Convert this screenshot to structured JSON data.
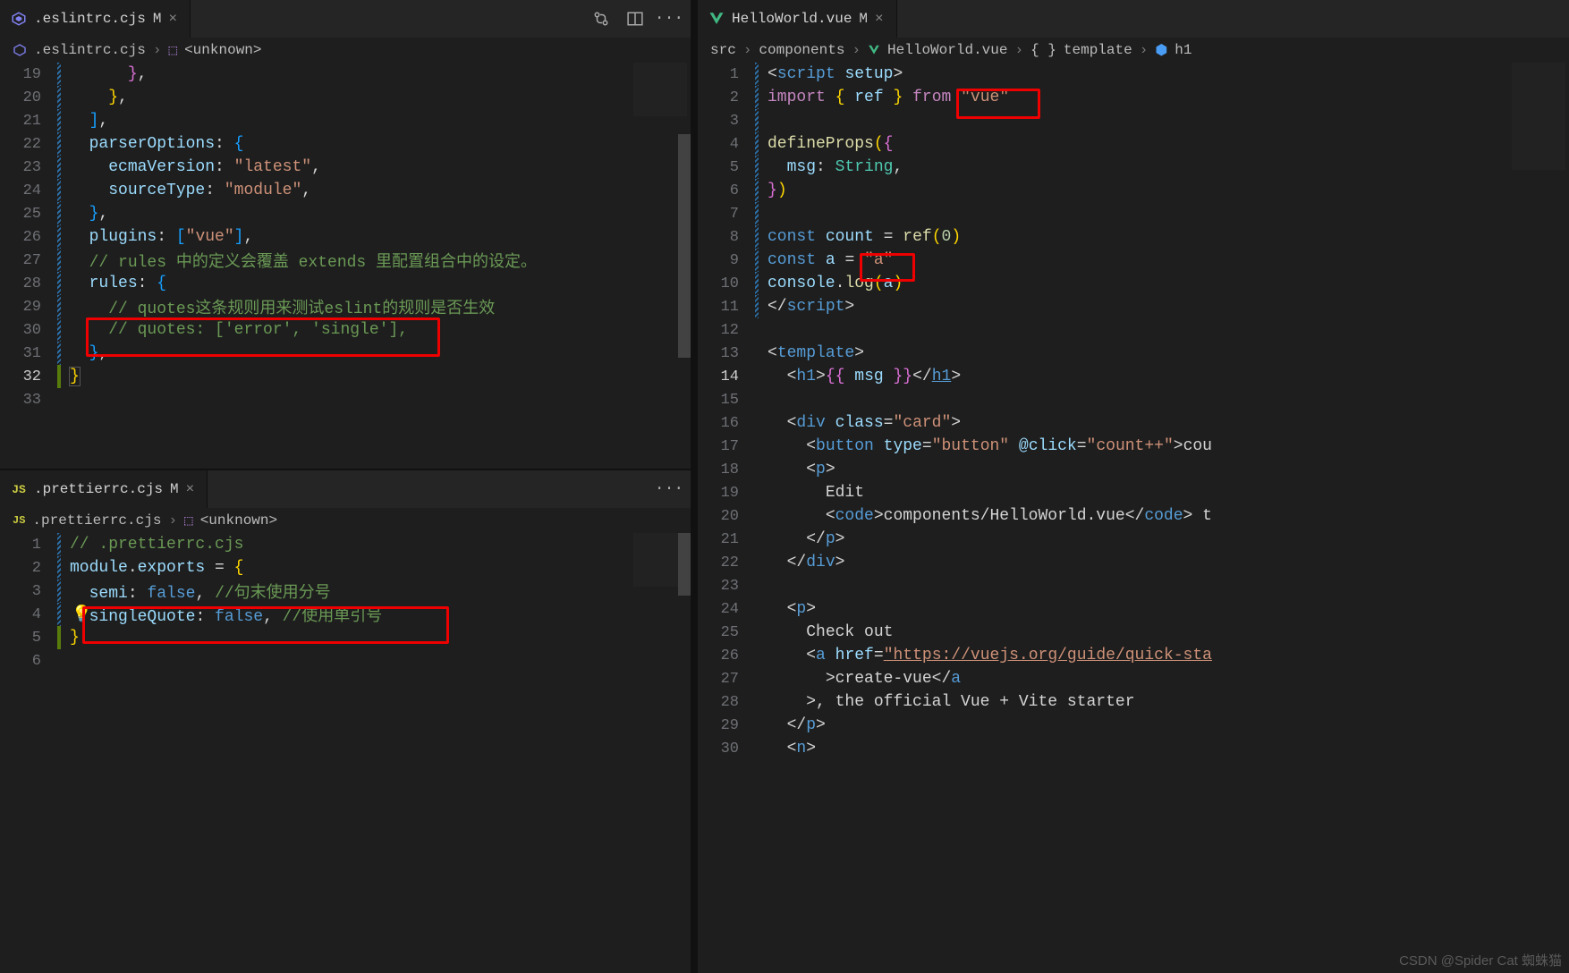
{
  "left_top": {
    "tab": {
      "name": ".eslintrc.cjs",
      "mod": "M"
    },
    "crumbs": [
      ".eslintrc.cjs",
      "<unknown>"
    ],
    "lines": [
      {
        "n": "19",
        "cls": "mod",
        "html": "      <span class='br2'>}</span><span class='pc'>,</span>"
      },
      {
        "n": "20",
        "cls": "mod",
        "html": "    <span class='br1'>}</span><span class='pc'>,</span>"
      },
      {
        "n": "21",
        "cls": "mod",
        "html": "  <span class='br3'>]</span><span class='pc'>,</span>"
      },
      {
        "n": "22",
        "cls": "mod",
        "html": "  <span class='ky'>parserOptions</span><span class='pc'>: </span><span class='br3'>{</span>"
      },
      {
        "n": "23",
        "cls": "mod",
        "html": "    <span class='ky'>ecmaVersion</span><span class='pc'>: </span><span class='st'>\"latest\"</span><span class='pc'>,</span>"
      },
      {
        "n": "24",
        "cls": "mod",
        "html": "    <span class='ky'>sourceType</span><span class='pc'>: </span><span class='st'>\"module\"</span><span class='pc'>,</span>"
      },
      {
        "n": "25",
        "cls": "mod",
        "html": "  <span class='br3'>}</span><span class='pc'>,</span>"
      },
      {
        "n": "26",
        "cls": "mod",
        "html": "  <span class='ky'>plugins</span><span class='pc'>: </span><span class='br3'>[</span><span class='st'>\"vue\"</span><span class='br3'>]</span><span class='pc'>,</span>"
      },
      {
        "n": "27",
        "cls": "mod",
        "html": "  <span class='ch'>// rules 中的定义会覆盖 extends 里配置组合中的设定。</span>"
      },
      {
        "n": "28",
        "cls": "mod",
        "html": "  <span class='ky'>rules</span><span class='pc'>: </span><span class='br3'>{</span>"
      },
      {
        "n": "29",
        "cls": "mod",
        "html": "    <span class='ch'>// quotes这条规则用来测试eslint的规则是否生效</span>"
      },
      {
        "n": "30",
        "cls": "mod",
        "html": "    <span class='ch'>// quotes: ['error', 'single'],</span>"
      },
      {
        "n": "31",
        "cls": "mod",
        "html": "  <span class='br3'>}</span><span class='pc'>,</span>"
      },
      {
        "n": "32",
        "cls": "add",
        "hl": true,
        "html": "<span class='br1' style='outline:1px solid #555'>}</span>"
      },
      {
        "n": "33",
        "cls": "",
        "html": ""
      }
    ]
  },
  "left_bottom": {
    "tab": {
      "name": ".prettierrc.cjs",
      "mod": "M"
    },
    "crumbs": [
      ".prettierrc.cjs",
      "<unknown>"
    ],
    "lines": [
      {
        "n": "1",
        "cls": "mod",
        "html": "<span class='ch'>// .prettierrc.cjs</span>"
      },
      {
        "n": "2",
        "cls": "mod",
        "html": "<span class='va'>module</span><span class='pc'>.</span><span class='va'>exports</span><span class='pc'> = </span><span class='br1'>{</span>"
      },
      {
        "n": "3",
        "cls": "mod",
        "html": "  <span class='ky'>semi</span><span class='pc'>: </span><span class='kw'>false</span><span class='pc'>, </span><span class='ch'>//句末使用分号</span>"
      },
      {
        "n": "4",
        "cls": "mod",
        "html": "  <span class='ky'>singleQuote</span><span class='pc'>: </span><span class='kw'>false</span><span class='pc'>, </span><span class='ch'>//使用单引号</span>"
      },
      {
        "n": "5",
        "cls": "add",
        "html": "<span class='br1'>}</span>"
      },
      {
        "n": "6",
        "cls": "",
        "html": ""
      }
    ]
  },
  "right": {
    "tab": {
      "name": "HelloWorld.vue",
      "mod": "M"
    },
    "crumbs": [
      "src",
      "components",
      "HelloWorld.vue",
      "template",
      "h1"
    ],
    "lines": [
      {
        "n": "1",
        "cls": "mod",
        "html": "<span class='pc'>&lt;</span><span class='tg'>script</span> <span class='at'>setup</span><span class='pc'>&gt;</span>"
      },
      {
        "n": "2",
        "cls": "mod",
        "html": "<span class='pc2'>import</span> <span class='br1'>{</span> <span class='va'>ref</span> <span class='br1'>}</span> <span class='pc2'>from</span> <span class='st'>\"vue\"</span>"
      },
      {
        "n": "3",
        "cls": "mod",
        "html": ""
      },
      {
        "n": "4",
        "cls": "mod",
        "html": "<span class='fn'>defineProps</span><span class='br1'>(</span><span class='br2'>{</span>"
      },
      {
        "n": "5",
        "cls": "mod",
        "html": "  <span class='ky'>msg</span><span class='pc'>: </span><span class='ty'>String</span><span class='pc'>,</span>"
      },
      {
        "n": "6",
        "cls": "mod",
        "html": "<span class='br2'>}</span><span class='br1'>)</span>"
      },
      {
        "n": "7",
        "cls": "mod",
        "html": ""
      },
      {
        "n": "8",
        "cls": "mod",
        "html": "<span class='kw'>const</span> <span class='va'>count</span> <span class='op'>=</span> <span class='fn'>ref</span><span class='br1'>(</span><span class='nm'>0</span><span class='br1'>)</span>"
      },
      {
        "n": "9",
        "cls": "mod",
        "html": "<span class='kw'>const</span> <span class='va'>a</span> <span class='op'>=</span> <span class='st'>\"a\"</span>"
      },
      {
        "n": "10",
        "cls": "mod",
        "html": "<span class='va'>console</span><span class='pc'>.</span><span class='fn'>log</span><span class='br1'>(</span><span class='va'>a</span><span class='br1'>)</span>"
      },
      {
        "n": "11",
        "cls": "mod",
        "html": "<span class='pc'>&lt;/</span><span class='tg'>script</span><span class='pc'>&gt;</span>"
      },
      {
        "n": "12",
        "cls": "",
        "html": ""
      },
      {
        "n": "13",
        "cls": "",
        "html": "<span class='pc'>&lt;</span><span class='tg'>template</span><span class='pc'>&gt;</span>"
      },
      {
        "n": "14",
        "cls": "",
        "hl": true,
        "hb": true,
        "html": "  <span class='pc'>&lt;</span><span class='tg'>h1</span><span class='pc'>&gt;</span><span class='br2'>{{</span> <span class='va'>msg</span> <span class='br2'>}}</span><span class='pc'>&lt;/</span><span class='tg' style='text-decoration:underline'>h1</span><span class='pc'>&gt;</span>"
      },
      {
        "n": "15",
        "cls": "",
        "html": ""
      },
      {
        "n": "16",
        "cls": "",
        "html": "  <span class='pc'>&lt;</span><span class='tg'>div</span> <span class='at'>class</span><span class='pc'>=</span><span class='st'>\"card\"</span><span class='pc'>&gt;</span>"
      },
      {
        "n": "17",
        "cls": "",
        "html": "    <span class='pc'>&lt;</span><span class='tg'>button</span> <span class='at'>type</span><span class='pc'>=</span><span class='st'>\"button\"</span> <span class='at'>@click</span><span class='pc'>=</span><span class='st'>\"count++\"</span><span class='pc'>&gt;</span><span class='dv'>cou</span>"
      },
      {
        "n": "18",
        "cls": "",
        "html": "    <span class='pc'>&lt;</span><span class='tg'>p</span><span class='pc'>&gt;</span>"
      },
      {
        "n": "19",
        "cls": "",
        "html": "      <span class='dv'>Edit</span>"
      },
      {
        "n": "20",
        "cls": "",
        "html": "      <span class='pc'>&lt;</span><span class='tg'>code</span><span class='pc'>&gt;</span><span class='dv'>components/HelloWorld.vue</span><span class='pc'>&lt;/</span><span class='tg'>code</span><span class='pc'>&gt;</span><span class='dv'> t</span>"
      },
      {
        "n": "21",
        "cls": "",
        "html": "    <span class='pc'>&lt;/</span><span class='tg'>p</span><span class='pc'>&gt;</span>"
      },
      {
        "n": "22",
        "cls": "",
        "html": "  <span class='pc'>&lt;/</span><span class='tg'>div</span><span class='pc'>&gt;</span>"
      },
      {
        "n": "23",
        "cls": "",
        "html": ""
      },
      {
        "n": "24",
        "cls": "",
        "html": "  <span class='pc'>&lt;</span><span class='tg'>p</span><span class='pc'>&gt;</span>"
      },
      {
        "n": "25",
        "cls": "",
        "html": "    <span class='dv'>Check out</span>"
      },
      {
        "n": "26",
        "cls": "",
        "html": "    <span class='pc'>&lt;</span><span class='tg'>a</span> <span class='at'>href</span><span class='pc'>=</span><span class='st' style='text-decoration:underline'>\"https://vuejs.org/guide/quick-sta</span>"
      },
      {
        "n": "27",
        "cls": "",
        "html": "      <span class='pc'>&gt;</span><span class='dv'>create-vue</span><span class='pc'>&lt;/</span><span class='tg'>a</span>"
      },
      {
        "n": "28",
        "cls": "",
        "html": "    <span class='pc'>&gt;</span><span class='dv'>, the official Vue + Vite starter</span>"
      },
      {
        "n": "29",
        "cls": "",
        "html": "  <span class='pc'>&lt;/</span><span class='tg'>p</span><span class='pc'>&gt;</span>"
      },
      {
        "n": "30",
        "cls": "",
        "html": "  <span class='pc'>&lt;</span><span class='tg'>n</span><span class='pc'>&gt;</span>"
      }
    ]
  },
  "watermark": "CSDN @Spider Cat 蜘蛛猫"
}
